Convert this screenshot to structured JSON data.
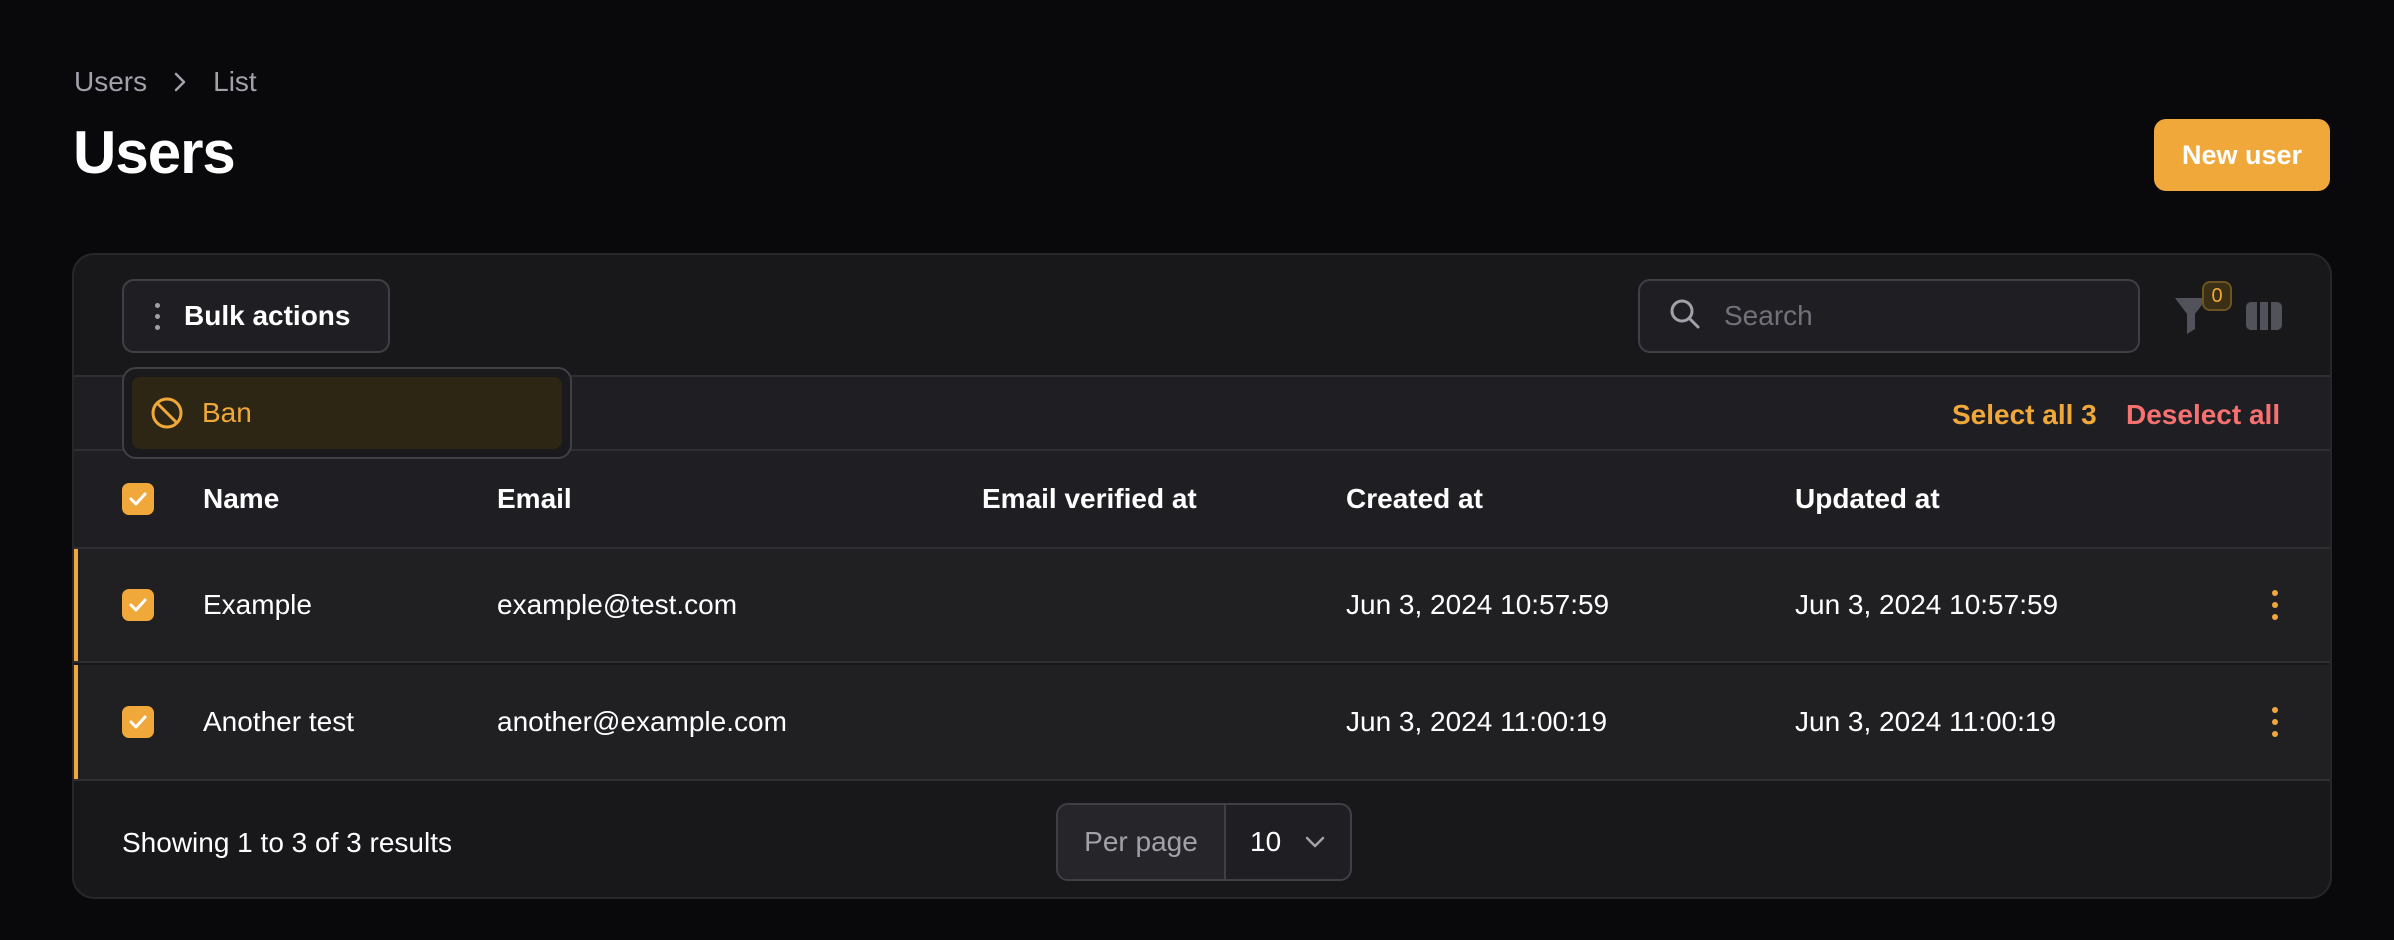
{
  "breadcrumb": {
    "items": [
      "Users",
      "List"
    ]
  },
  "page": {
    "title": "Users"
  },
  "header": {
    "new_user_label": "New user"
  },
  "toolbar": {
    "bulk_actions_label": "Bulk actions",
    "search_placeholder": "Search",
    "filter_count": "0",
    "icons": {
      "bulk": "vertical-dots-icon",
      "search": "search-icon",
      "filter": "filter-icon",
      "columns": "columns-icon"
    }
  },
  "bulk_menu": {
    "items": [
      {
        "label": "Ban",
        "icon": "ban-icon"
      }
    ]
  },
  "selection": {
    "select_all_label": "Select all 3",
    "deselect_all_label": "Deselect all"
  },
  "table": {
    "columns": [
      "Name",
      "Email",
      "Email verified at",
      "Created at",
      "Updated at"
    ],
    "rows": [
      {
        "name": "Example",
        "email": "example@test.com",
        "email_verified_at": "",
        "created_at": "Jun 3, 2024 10:57:59",
        "updated_at": "Jun 3, 2024 10:57:59",
        "checked": true
      },
      {
        "name": "Another test",
        "email": "another@example.com",
        "email_verified_at": "",
        "created_at": "Jun 3, 2024 11:00:19",
        "updated_at": "Jun 3, 2024 11:00:19",
        "checked": true
      }
    ]
  },
  "pagination": {
    "summary": "Showing 1 to 3 of 3 results",
    "per_page_label": "Per page",
    "per_page_value": "10"
  },
  "colors": {
    "accent": "#f0a83a",
    "danger": "#f87171",
    "background": "#09090b",
    "card": "#18181b"
  }
}
